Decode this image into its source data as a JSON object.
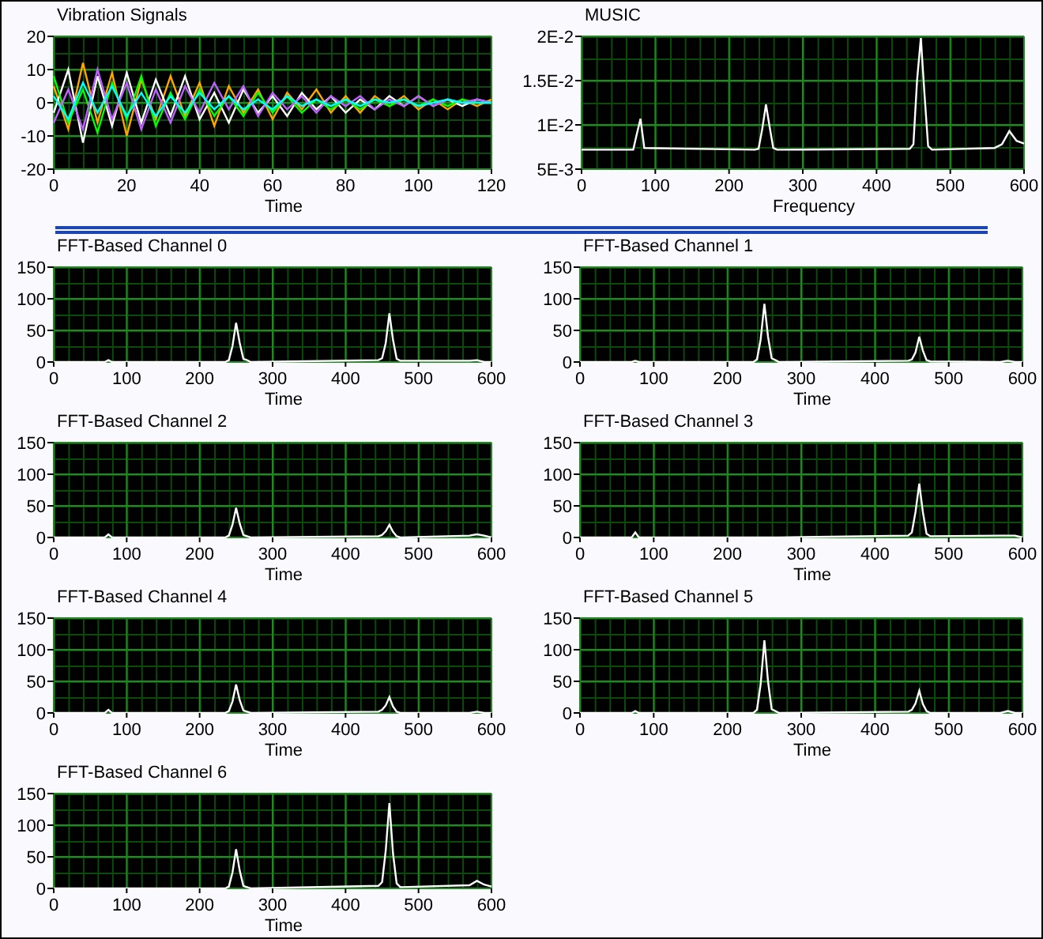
{
  "top_charts": [
    {
      "title": "Vibration Signals",
      "chart_data": {
        "type": "line",
        "grid": true,
        "xlabel": "Time",
        "x": [
          0,
          4,
          8,
          12,
          16,
          20,
          24,
          28,
          32,
          36,
          40,
          44,
          48,
          52,
          56,
          60,
          64,
          68,
          72,
          76,
          80,
          84,
          88,
          92,
          96,
          100,
          104,
          108,
          112,
          116,
          120
        ],
        "xlim": [
          0,
          120
        ],
        "ylim": [
          -20,
          20
        ],
        "xticks": [
          0,
          20,
          40,
          60,
          80,
          100,
          120
        ],
        "yticks": [
          -20,
          -10,
          0,
          10,
          20
        ],
        "series": [
          {
            "color": "#ffa500",
            "values": [
              5,
              -8,
              12,
              -6,
              9,
              -10,
              7,
              -5,
              8,
              -4,
              6,
              -7,
              5,
              -3,
              4,
              -5,
              3,
              -2,
              4,
              -3,
              2,
              -3,
              2,
              -1,
              2,
              -2,
              1,
              -2,
              1,
              -1,
              1
            ]
          },
          {
            "color": "#ffffff",
            "values": [
              -3,
              10,
              -12,
              8,
              -7,
              9,
              -6,
              7,
              -4,
              8,
              -5,
              3,
              -6,
              4,
              -3,
              2,
              -4,
              3,
              -2,
              2,
              -3,
              1,
              -2,
              2,
              -1,
              2,
              -1,
              1,
              -1,
              1,
              0
            ]
          },
          {
            "color": "#00ff00",
            "values": [
              8,
              -6,
              4,
              -9,
              6,
              -5,
              8,
              -7,
              3,
              -5,
              4,
              -4,
              2,
              -4,
              3,
              -3,
              2,
              -3,
              1,
              -2,
              1,
              -2,
              1,
              -1,
              1,
              -1,
              1,
              -1,
              1,
              0,
              0
            ]
          },
          {
            "color": "#c060ff",
            "values": [
              -6,
              4,
              -8,
              10,
              -5,
              6,
              -8,
              4,
              -6,
              5,
              -3,
              6,
              -2,
              5,
              -4,
              3,
              -2,
              2,
              -3,
              2,
              -1,
              2,
              -2,
              1,
              -1,
              2,
              -1,
              1,
              0,
              1,
              0
            ]
          },
          {
            "color": "#00ffff",
            "values": [
              2,
              -5,
              6,
              -3,
              5,
              -4,
              3,
              -4,
              2,
              -3,
              3,
              -2,
              2,
              -2,
              1,
              -2,
              2,
              -1,
              1,
              -1,
              1,
              -1,
              1,
              0,
              1,
              -1,
              0,
              1,
              0,
              0,
              0
            ]
          }
        ]
      }
    },
    {
      "title": "MUSIC",
      "chart_data": {
        "type": "line",
        "grid": true,
        "xlabel": "Frequency",
        "x": [
          0,
          70,
          75,
          80,
          85,
          235,
          240,
          245,
          250,
          255,
          260,
          265,
          270,
          445,
          450,
          455,
          460,
          465,
          470,
          475,
          560,
          570,
          580,
          590,
          600
        ],
        "xlim": [
          0,
          600
        ],
        "ylim": [
          0.005,
          0.02
        ],
        "xticks": [
          0,
          100,
          200,
          300,
          400,
          500,
          600
        ],
        "yticks": [
          {
            "value": 0.005,
            "label": "5E-3"
          },
          {
            "value": 0.01,
            "label": "1E-2"
          },
          {
            "value": 0.015,
            "label": "1.5E-2"
          },
          {
            "value": 0.02,
            "label": "2E-2"
          }
        ],
        "series": [
          {
            "color": "#ffffff",
            "values": [
              0.0072,
              0.0072,
              0.009,
              0.0107,
              0.0074,
              0.0072,
              0.0073,
              0.0095,
              0.0123,
              0.0098,
              0.0074,
              0.0072,
              0.0072,
              0.0073,
              0.0078,
              0.015,
              0.0198,
              0.0135,
              0.0076,
              0.0072,
              0.0074,
              0.0078,
              0.0093,
              0.0082,
              0.0079
            ]
          }
        ]
      }
    }
  ],
  "fft_charts": [
    {
      "title": "FFT-Based Channel 0",
      "chart_data": {
        "type": "line",
        "grid": true,
        "xlabel": "Time",
        "x": [
          0,
          70,
          75,
          80,
          85,
          235,
          240,
          245,
          250,
          255,
          260,
          265,
          270,
          445,
          450,
          455,
          460,
          465,
          470,
          475,
          570,
          580,
          590,
          600
        ],
        "xlim": [
          0,
          600
        ],
        "ylim": [
          0,
          150
        ],
        "xticks": [
          0,
          100,
          200,
          300,
          400,
          500,
          600
        ],
        "yticks": [
          0,
          50,
          100,
          150
        ],
        "series": [
          {
            "color": "#ffffff",
            "values": [
              0,
              0,
              3,
              0,
              0,
              0,
              3,
              25,
              62,
              30,
              5,
              3,
              0,
              3,
              6,
              30,
              77,
              35,
              5,
              2,
              2,
              3,
              0,
              0
            ]
          }
        ]
      }
    },
    {
      "title": "FFT-Based Channel 1",
      "chart_data": {
        "type": "line",
        "grid": true,
        "xlabel": "Time",
        "x": [
          0,
          70,
          75,
          80,
          85,
          235,
          240,
          245,
          250,
          255,
          260,
          265,
          270,
          445,
          450,
          455,
          460,
          465,
          470,
          475,
          570,
          580,
          590,
          600
        ],
        "xlim": [
          0,
          600
        ],
        "ylim": [
          0,
          150
        ],
        "xticks": [
          0,
          100,
          200,
          300,
          400,
          500,
          600
        ],
        "yticks": [
          0,
          50,
          100,
          150
        ],
        "series": [
          {
            "color": "#ffffff",
            "values": [
              0,
              0,
              2,
              0,
              0,
              0,
              4,
              35,
              92,
              40,
              6,
              3,
              0,
              2,
              4,
              15,
              40,
              18,
              3,
              1,
              0,
              2,
              0,
              0
            ]
          }
        ]
      }
    },
    {
      "title": "FFT-Based Channel 2",
      "chart_data": {
        "type": "line",
        "grid": true,
        "xlabel": "Time",
        "x": [
          0,
          70,
          75,
          80,
          85,
          235,
          240,
          245,
          250,
          255,
          260,
          265,
          270,
          445,
          450,
          455,
          460,
          465,
          470,
          475,
          570,
          580,
          590,
          600
        ],
        "xlim": [
          0,
          600
        ],
        "ylim": [
          0,
          150
        ],
        "xticks": [
          0,
          100,
          200,
          300,
          400,
          500,
          600
        ],
        "yticks": [
          0,
          50,
          100,
          150
        ],
        "series": [
          {
            "color": "#ffffff",
            "values": [
              0,
              0,
              5,
              0,
              0,
              0,
              3,
              20,
              47,
              22,
              4,
              2,
              0,
              2,
              4,
              10,
              20,
              9,
              2,
              0,
              3,
              5,
              3,
              0
            ]
          }
        ]
      }
    },
    {
      "title": "FFT-Based Channel 3",
      "chart_data": {
        "type": "line",
        "grid": true,
        "xlabel": "Time",
        "x": [
          0,
          70,
          75,
          80,
          85,
          235,
          240,
          245,
          250,
          255,
          260,
          265,
          270,
          445,
          450,
          455,
          460,
          465,
          470,
          475,
          570,
          580,
          590,
          600
        ],
        "xlim": [
          0,
          600
        ],
        "ylim": [
          0,
          150
        ],
        "xticks": [
          0,
          100,
          200,
          300,
          400,
          500,
          600
        ],
        "yticks": [
          0,
          50,
          100,
          150
        ],
        "series": [
          {
            "color": "#ffffff",
            "values": [
              0,
              0,
              8,
              0,
              0,
              0,
              0,
              0,
              0,
              0,
              0,
              0,
              0,
              3,
              8,
              40,
              85,
              40,
              6,
              2,
              3,
              3,
              3,
              0
            ]
          }
        ]
      }
    },
    {
      "title": "FFT-Based Channel 4",
      "chart_data": {
        "type": "line",
        "grid": true,
        "xlabel": "Time",
        "x": [
          0,
          70,
          75,
          80,
          85,
          235,
          240,
          245,
          250,
          255,
          260,
          265,
          270,
          445,
          450,
          455,
          460,
          465,
          470,
          475,
          570,
          580,
          590,
          600
        ],
        "xlim": [
          0,
          600
        ],
        "ylim": [
          0,
          150
        ],
        "xticks": [
          0,
          100,
          200,
          300,
          400,
          500,
          600
        ],
        "yticks": [
          0,
          50,
          100,
          150
        ],
        "series": [
          {
            "color": "#ffffff",
            "values": [
              0,
              0,
              5,
              0,
              0,
              0,
              3,
              18,
              45,
              20,
              4,
              2,
              0,
              2,
              5,
              12,
              25,
              10,
              2,
              0,
              0,
              2,
              0,
              0
            ]
          }
        ]
      }
    },
    {
      "title": "FFT-Based Channel 5",
      "chart_data": {
        "type": "line",
        "grid": true,
        "xlabel": "Time",
        "x": [
          0,
          70,
          75,
          80,
          85,
          235,
          240,
          245,
          250,
          255,
          260,
          265,
          270,
          445,
          450,
          455,
          460,
          465,
          470,
          475,
          570,
          580,
          590,
          600
        ],
        "xlim": [
          0,
          600
        ],
        "ylim": [
          0,
          150
        ],
        "xticks": [
          0,
          100,
          200,
          300,
          400,
          500,
          600
        ],
        "yticks": [
          0,
          50,
          100,
          150
        ],
        "series": [
          {
            "color": "#ffffff",
            "values": [
              0,
              0,
              3,
              0,
              0,
              0,
              5,
              45,
              115,
              50,
              6,
              3,
              0,
              2,
              5,
              15,
              35,
              14,
              3,
              0,
              0,
              3,
              0,
              0
            ]
          }
        ]
      }
    },
    {
      "title": "FFT-Based Channel 6",
      "chart_data": {
        "type": "line",
        "grid": true,
        "xlabel": "Time",
        "x": [
          0,
          70,
          75,
          80,
          85,
          235,
          240,
          245,
          250,
          255,
          260,
          265,
          270,
          445,
          450,
          455,
          460,
          465,
          470,
          475,
          570,
          580,
          590,
          600
        ],
        "xlim": [
          0,
          600
        ],
        "ylim": [
          0,
          150
        ],
        "xticks": [
          0,
          100,
          200,
          300,
          400,
          500,
          600
        ],
        "yticks": [
          0,
          50,
          100,
          150
        ],
        "series": [
          {
            "color": "#ffffff",
            "values": [
              0,
              0,
              0,
              0,
              0,
              0,
              3,
              25,
              62,
              28,
              4,
              2,
              0,
              4,
              10,
              60,
              135,
              55,
              8,
              2,
              5,
              12,
              6,
              3
            ]
          }
        ]
      }
    }
  ]
}
